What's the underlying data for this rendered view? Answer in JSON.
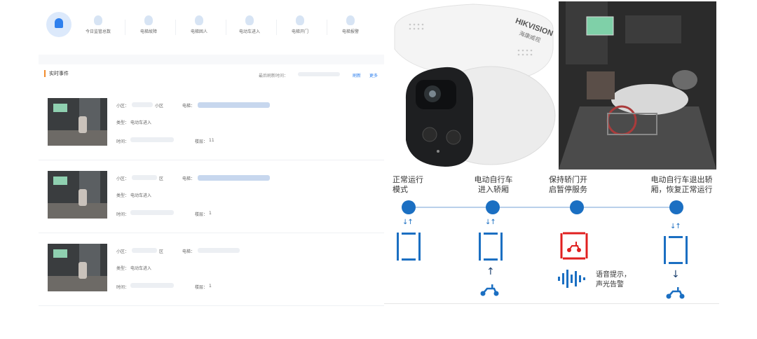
{
  "nav": {
    "items": [
      {
        "label": "今日监管总数",
        "icon": "bell-icon"
      },
      {
        "label": "电梯故障",
        "icon": "warning-icon"
      },
      {
        "label": "电梯困人",
        "icon": "person-icon"
      },
      {
        "label": "电动车进入",
        "icon": "scooter-icon"
      },
      {
        "label": "电梯开门",
        "icon": "door-icon"
      },
      {
        "label": "电梯报警",
        "icon": "alarm-icon"
      }
    ]
  },
  "events": {
    "title": "实时事件",
    "refresh_time_label": "最后刷新时间：",
    "refresh_link": "刷新",
    "more_link": "更多",
    "list": [
      {
        "community_label": "小区：",
        "community_value": "小区",
        "elevator_label": "电梯：",
        "type_label": "类型：",
        "type_value": "电动车进入",
        "time_label": "时间：",
        "floor_label": "楼层：",
        "floor_value": "11"
      },
      {
        "community_label": "小区：",
        "community_value": "区",
        "elevator_label": "电梯：",
        "type_label": "类型：",
        "type_value": "电动车进入",
        "time_label": "时间：",
        "floor_label": "楼层：",
        "floor_value": "1"
      },
      {
        "community_label": "小区：",
        "community_value": "区",
        "elevator_label": "电梯：",
        "type_label": "类型：",
        "type_value": "电动车进入",
        "time_label": "时间：",
        "floor_label": "楼层：",
        "floor_value": "1"
      }
    ]
  },
  "camera": {
    "brand": "HIKVISION",
    "brand_cn": "海康威视"
  },
  "timeline": {
    "steps": [
      {
        "label_line1": "正常运行",
        "label_line2": "模式"
      },
      {
        "label_line1": "电动自行车",
        "label_line2": "进入轿厢"
      },
      {
        "label_line1": "保持轿门开",
        "label_line2": "启暂停服务"
      },
      {
        "label_line1": "电动自行车退出轿",
        "label_line2": "厢，恢复正常运行"
      }
    ],
    "voice_note_line1": "语音提示，",
    "voice_note_line2": "声光告警",
    "accent_color": "#1b6fc2",
    "alert_color": "#e02020"
  }
}
